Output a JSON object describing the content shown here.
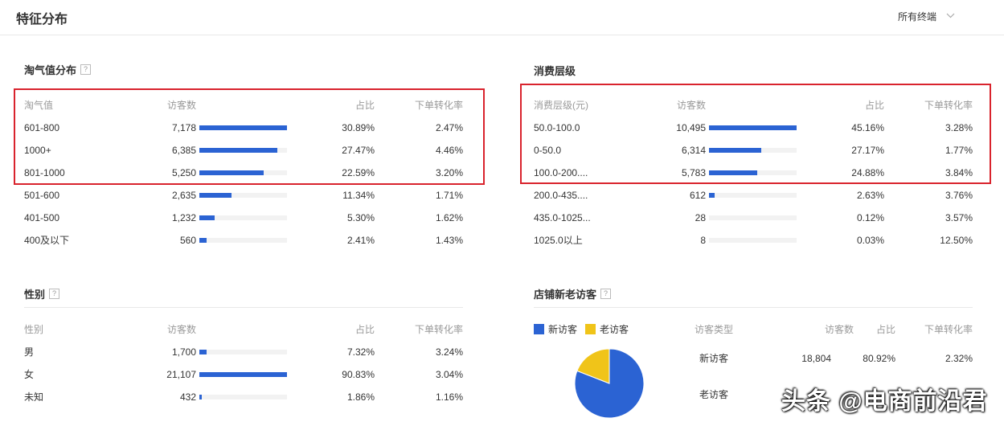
{
  "header": {
    "title": "特征分布",
    "terminal_select": "所有终端"
  },
  "taoqi": {
    "title": "淘气值分布",
    "columns": [
      "淘气值",
      "访客数",
      "占比",
      "下单转化率"
    ],
    "rows": [
      {
        "label": "601-800",
        "visitors": "7,178",
        "share": "30.89%",
        "conversion": "2.47%",
        "bar": 1.0
      },
      {
        "label": "1000+",
        "visitors": "6,385",
        "share": "27.47%",
        "conversion": "4.46%",
        "bar": 0.89
      },
      {
        "label": "801-1000",
        "visitors": "5,250",
        "share": "22.59%",
        "conversion": "3.20%",
        "bar": 0.73
      },
      {
        "label": "501-600",
        "visitors": "2,635",
        "share": "11.34%",
        "conversion": "1.71%",
        "bar": 0.37
      },
      {
        "label": "401-500",
        "visitors": "1,232",
        "share": "5.30%",
        "conversion": "1.62%",
        "bar": 0.17
      },
      {
        "label": "400及以下",
        "visitors": "560",
        "share": "2.41%",
        "conversion": "1.43%",
        "bar": 0.08
      }
    ]
  },
  "spending": {
    "title": "消费层级",
    "columns": [
      "消费层级(元)",
      "访客数",
      "占比",
      "下单转化率"
    ],
    "rows": [
      {
        "label": "50.0-100.0",
        "visitors": "10,495",
        "share": "45.16%",
        "conversion": "3.28%",
        "bar": 1.0
      },
      {
        "label": "0-50.0",
        "visitors": "6,314",
        "share": "27.17%",
        "conversion": "1.77%",
        "bar": 0.6
      },
      {
        "label": "100.0-200....",
        "visitors": "5,783",
        "share": "24.88%",
        "conversion": "3.84%",
        "bar": 0.55
      },
      {
        "label": "200.0-435....",
        "visitors": "612",
        "share": "2.63%",
        "conversion": "3.76%",
        "bar": 0.06
      },
      {
        "label": "435.0-1025...",
        "visitors": "28",
        "share": "0.12%",
        "conversion": "3.57%",
        "bar": 0.0
      },
      {
        "label": "1025.0以上",
        "visitors": "8",
        "share": "0.03%",
        "conversion": "12.50%",
        "bar": 0.0
      }
    ]
  },
  "gender": {
    "title": "性别",
    "columns": [
      "性别",
      "访客数",
      "占比",
      "下单转化率"
    ],
    "rows": [
      {
        "label": "男",
        "visitors": "1,700",
        "share": "7.32%",
        "conversion": "3.24%",
        "bar": 0.08
      },
      {
        "label": "女",
        "visitors": "21,107",
        "share": "90.83%",
        "conversion": "3.04%",
        "bar": 1.0
      },
      {
        "label": "未知",
        "visitors": "432",
        "share": "1.86%",
        "conversion": "1.16%",
        "bar": 0.02
      }
    ]
  },
  "newold": {
    "title": "店铺新老访客",
    "legend": [
      {
        "label": "新访客",
        "color": "#2b63d3"
      },
      {
        "label": "老访客",
        "color": "#f0c419"
      }
    ],
    "columns": [
      "访客类型",
      "访客数",
      "占比",
      "下单转化率"
    ],
    "rows": [
      {
        "label": "新访客",
        "visitors": "18,804",
        "share": "80.92%",
        "conversion": "2.32%"
      },
      {
        "label": "老访客",
        "visitors": "",
        "share": "",
        "conversion": ""
      }
    ],
    "pie": {
      "new_share": 80.92,
      "old_share": 19.08
    }
  },
  "watermark": "头条 @电商前沿君",
  "colors": {
    "bar": "#2b63d3",
    "bar_track": "#f2f2f2",
    "highlight": "#d9232d",
    "old_visitor": "#f0c419"
  }
}
